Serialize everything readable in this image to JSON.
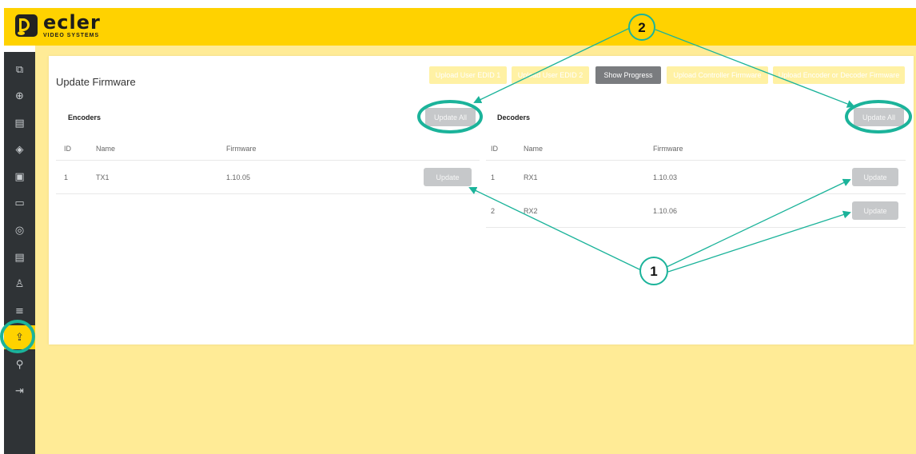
{
  "brand": {
    "logo_word": "ecler",
    "logo_sub": "VIDEO SYSTEMS",
    "brand_color": "#ffd200",
    "page_bg_color": "#ffeb96",
    "sidebar_color": "#2f3336"
  },
  "sidebar": {
    "items": [
      {
        "icon": "monitor-search-icon",
        "glyph": "⧉"
      },
      {
        "icon": "add-circle-icon",
        "glyph": "⊕"
      },
      {
        "icon": "grid-icon",
        "glyph": "▤"
      },
      {
        "icon": "layers-icon",
        "glyph": "◈"
      },
      {
        "icon": "screen-play-icon",
        "glyph": "▣"
      },
      {
        "icon": "display-icon",
        "glyph": "▭"
      },
      {
        "icon": "target-icon",
        "glyph": "◎"
      },
      {
        "icon": "panel-icon",
        "glyph": "▤"
      },
      {
        "icon": "user-icon",
        "glyph": "♙"
      },
      {
        "icon": "sliders-icon",
        "glyph": "≡"
      },
      {
        "icon": "upload-firmware-icon",
        "glyph": "⇪",
        "active": true
      },
      {
        "icon": "tools-icon",
        "glyph": "⚲"
      },
      {
        "icon": "logout-icon",
        "glyph": "⇥"
      }
    ]
  },
  "page": {
    "title": "Update Firmware"
  },
  "toolbar": {
    "upload_edid_1": "Upload User EDID 1",
    "upload_edid_2": "Upload User EDID 2",
    "show_progress": "Show Progress",
    "upload_controller": "Upload Controller Firmware",
    "upload_encoder_decoder": "Upload Encoder or Decoder Firmware"
  },
  "encoders": {
    "title": "Encoders",
    "update_all": "Update All",
    "columns": [
      "ID",
      "Name",
      "Firmware"
    ],
    "rows": [
      {
        "id": "1",
        "name": "TX1",
        "firmware": "1.10.05",
        "button": "Update"
      }
    ]
  },
  "decoders": {
    "title": "Decoders",
    "update_all": "Update All",
    "columns": [
      "ID",
      "Name",
      "Firmware"
    ],
    "rows": [
      {
        "id": "1",
        "name": "RX1",
        "firmware": "1.10.03",
        "button": "Update"
      },
      {
        "id": "2",
        "name": "RX2",
        "firmware": "1.10.06",
        "button": "Update"
      }
    ]
  },
  "callouts": {
    "one": "1",
    "two": "2",
    "color": "#1bb39a"
  }
}
